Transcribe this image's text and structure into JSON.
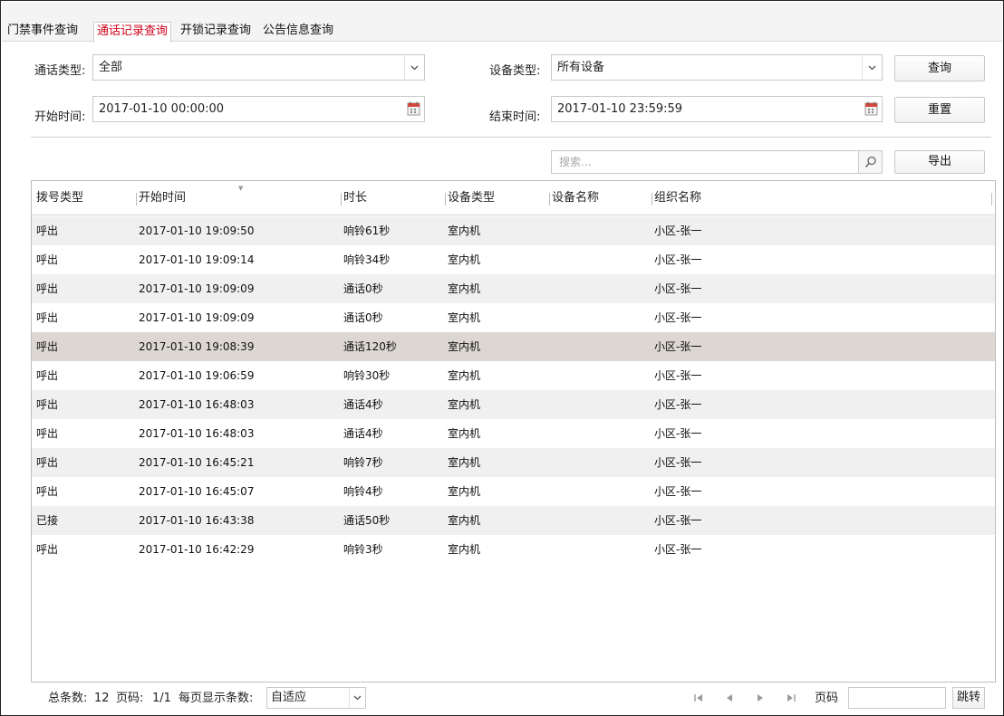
{
  "tabs": [
    {
      "label": "门禁事件查询"
    },
    {
      "label": "通话记录查询"
    },
    {
      "label": "开锁记录查询"
    },
    {
      "label": "公告信息查询"
    }
  ],
  "filters": {
    "call_type_label": "通话类型:",
    "call_type_value": "全部",
    "device_type_label": "设备类型:",
    "device_type_value": "所有设备",
    "start_label": "开始时间:",
    "start_value": "2017-01-10 00:00:00",
    "end_label": "结束时间:",
    "end_value": "2017-01-10 23:59:59",
    "query_button": "查询",
    "reset_button": "重置",
    "search_placeholder": "搜索...",
    "export_button": "导出"
  },
  "table": {
    "columns": [
      "拨号类型",
      "开始时间",
      "时长",
      "设备类型",
      "设备名称",
      "组织名称"
    ],
    "rows": [
      [
        "呼出",
        "2017-01-10 19:09:50",
        "响铃61秒",
        "室内机",
        "",
        "小区-张一"
      ],
      [
        "呼出",
        "2017-01-10 19:09:14",
        "响铃34秒",
        "室内机",
        "",
        "小区-张一"
      ],
      [
        "呼出",
        "2017-01-10 19:09:09",
        "通话0秒",
        "室内机",
        "",
        "小区-张一"
      ],
      [
        "呼出",
        "2017-01-10 19:09:09",
        "通话0秒",
        "室内机",
        "",
        "小区-张一"
      ],
      [
        "呼出",
        "2017-01-10 19:08:39",
        "通话120秒",
        "室内机",
        "",
        "小区-张一"
      ],
      [
        "呼出",
        "2017-01-10 19:06:59",
        "响铃30秒",
        "室内机",
        "",
        "小区-张一"
      ],
      [
        "呼出",
        "2017-01-10 16:48:03",
        "通话4秒",
        "室内机",
        "",
        "小区-张一"
      ],
      [
        "呼出",
        "2017-01-10 16:48:03",
        "通话4秒",
        "室内机",
        "",
        "小区-张一"
      ],
      [
        "呼出",
        "2017-01-10 16:45:21",
        "响铃7秒",
        "室内机",
        "",
        "小区-张一"
      ],
      [
        "呼出",
        "2017-01-10 16:45:07",
        "响铃4秒",
        "室内机",
        "",
        "小区-张一"
      ],
      [
        "已接",
        "2017-01-10 16:43:38",
        "通话50秒",
        "室内机",
        "",
        "小区-张一"
      ],
      [
        "呼出",
        "2017-01-10 16:42:29",
        "响铃3秒",
        "室内机",
        "",
        "小区-张一"
      ]
    ]
  },
  "footer": {
    "total_label": "总条数:",
    "total_value": "12",
    "page_label": "页码:",
    "page_value": "1/1",
    "per_page_label": "每页显示条数:",
    "per_page_value": "自适应",
    "page_input_label": "页码",
    "jump_button": "跳转"
  },
  "colors": {
    "active_tab": "#d0021b",
    "selected_row": "#dcd7d1",
    "alt_row": "#f0f0f0"
  }
}
